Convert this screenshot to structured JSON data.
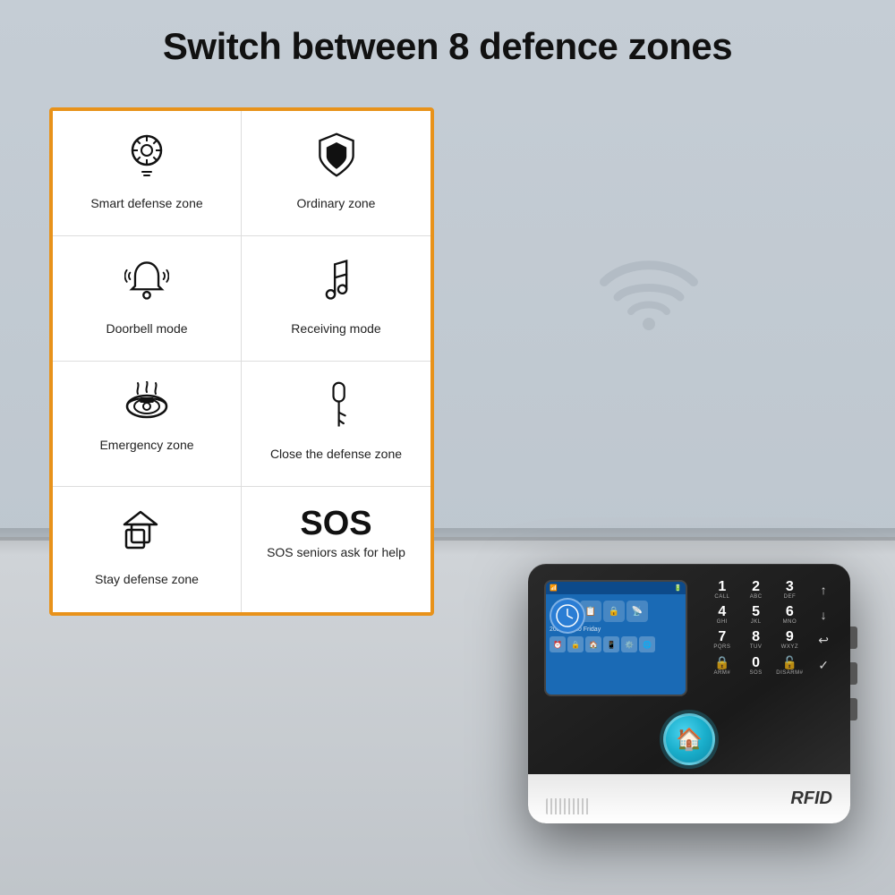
{
  "heading": "Switch between 8 defence zones",
  "zones": [
    {
      "id": "smart-defense",
      "icon": "🧠",
      "label": "Smart defense zone",
      "icon_type": "brain-gear"
    },
    {
      "id": "ordinary-zone",
      "icon": "🛡",
      "label": "Ordinary zone",
      "icon_type": "shield"
    },
    {
      "id": "doorbell-mode",
      "icon": "🔔",
      "label": "Doorbell mode",
      "icon_type": "bell"
    },
    {
      "id": "receiving-mode",
      "icon": "♪",
      "label": "Receiving mode",
      "icon_type": "music-note"
    },
    {
      "id": "emergency-zone",
      "icon": "🔴",
      "label": "Emergency zone",
      "icon_type": "smoke-detector"
    },
    {
      "id": "close-defense",
      "icon": "🔑",
      "label": "Close the defense zone",
      "icon_type": "key"
    },
    {
      "id": "stay-defense",
      "icon": "⬜",
      "label": "Stay defense zone",
      "icon_type": "home-shapes"
    },
    {
      "id": "sos",
      "label_top": "SOS",
      "label_bottom": "SOS seniors ask for help",
      "icon_type": "sos"
    }
  ],
  "device": {
    "rfid_label": "RFID",
    "brand": "RFID"
  },
  "colors": {
    "orange_border": "#e8921a",
    "heading_color": "#111111",
    "wifi_color": "#9aa5ae"
  }
}
